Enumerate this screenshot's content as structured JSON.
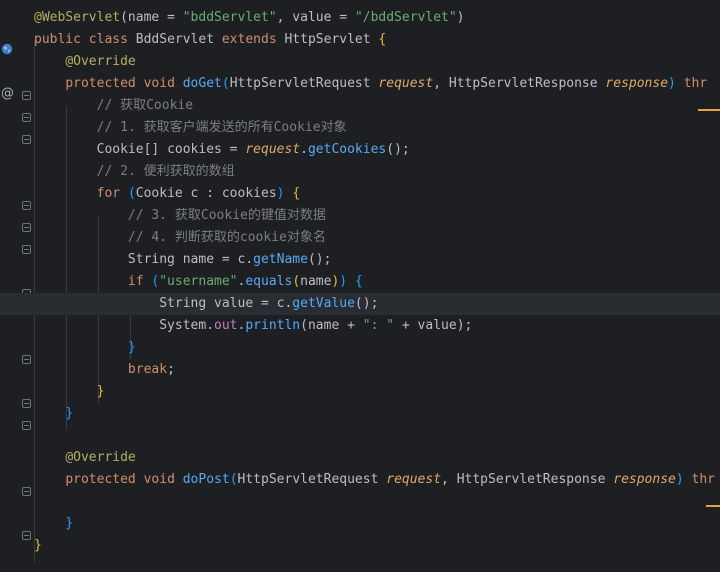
{
  "editor": {
    "language": "java",
    "lines": [
      [
        [
          "@WebServlet",
          "c-ann"
        ],
        [
          "(",
          "c-punct"
        ],
        [
          "name",
          "c-plain"
        ],
        [
          " = ",
          "c-plain"
        ],
        [
          "\"bddServlet\"",
          "c-str"
        ],
        [
          ", ",
          "c-plain"
        ],
        [
          "value",
          "c-plain"
        ],
        [
          " = ",
          "c-plain"
        ],
        [
          "\"/bddServlet\"",
          "c-str"
        ],
        [
          ")",
          "c-punct"
        ]
      ],
      [
        [
          "public ",
          "c-kw"
        ],
        [
          "class ",
          "c-kw"
        ],
        [
          "BddServlet ",
          "c-plain"
        ],
        [
          "extends ",
          "c-kw"
        ],
        [
          "HttpServlet ",
          "c-plain"
        ],
        [
          "{",
          "c-brace"
        ]
      ],
      [
        [
          "    ",
          "c-plain"
        ],
        [
          "@Override",
          "c-ann"
        ]
      ],
      [
        [
          "    ",
          "c-plain"
        ],
        [
          "protected ",
          "c-kw"
        ],
        [
          "void ",
          "c-kw"
        ],
        [
          "doGet",
          "c-fn"
        ],
        [
          "(",
          "c-brace2"
        ],
        [
          "HttpServletRequest ",
          "c-plain"
        ],
        [
          "request",
          "c-param"
        ],
        [
          ", ",
          "c-plain"
        ],
        [
          "HttpServletResponse ",
          "c-plain"
        ],
        [
          "response",
          "c-param"
        ],
        [
          ") ",
          "c-brace2"
        ],
        [
          "thr",
          "c-kw"
        ]
      ],
      [
        [
          "        ",
          "c-plain"
        ],
        [
          "// 获取Cookie",
          "c-cmt"
        ]
      ],
      [
        [
          "        ",
          "c-plain"
        ],
        [
          "// 1. 获取客户端发送的所有Cookie对象",
          "c-cmt"
        ]
      ],
      [
        [
          "        ",
          "c-plain"
        ],
        [
          "Cookie[] cookies = ",
          "c-plain"
        ],
        [
          "request",
          "c-param"
        ],
        [
          ".",
          "c-plain"
        ],
        [
          "getCookies",
          "c-mcall"
        ],
        [
          "();",
          "c-plain"
        ]
      ],
      [
        [
          "        ",
          "c-plain"
        ],
        [
          "// 2. 便利获取的数组",
          "c-cmt"
        ]
      ],
      [
        [
          "        ",
          "c-plain"
        ],
        [
          "for ",
          "c-kw"
        ],
        [
          "(",
          "c-brace2"
        ],
        [
          "Cookie c : cookies",
          "c-plain"
        ],
        [
          ") ",
          "c-brace2"
        ],
        [
          "{",
          "c-brace"
        ]
      ],
      [
        [
          "            ",
          "c-plain"
        ],
        [
          "// 3. 获取Cookie的键值对数据",
          "c-cmt"
        ]
      ],
      [
        [
          "            ",
          "c-plain"
        ],
        [
          "// 4. 判断获取的cookie对象名",
          "c-cmt"
        ]
      ],
      [
        [
          "            ",
          "c-plain"
        ],
        [
          "String name = c.",
          "c-plain"
        ],
        [
          "getName",
          "c-mcall"
        ],
        [
          "();",
          "c-plain"
        ]
      ],
      [
        [
          "            ",
          "c-plain"
        ],
        [
          "if ",
          "c-kw"
        ],
        [
          "(",
          "c-brace2"
        ],
        [
          "\"username\"",
          "c-str"
        ],
        [
          ".",
          "c-plain"
        ],
        [
          "equals",
          "c-mcall"
        ],
        [
          "(",
          "c-brace"
        ],
        [
          "name",
          "c-plain"
        ],
        [
          ")",
          "c-brace"
        ],
        [
          ") ",
          "c-brace2"
        ],
        [
          "{",
          "c-brace2"
        ]
      ],
      [
        [
          "                ",
          "c-plain"
        ],
        [
          "String value = c.",
          "c-plain"
        ],
        [
          "getValue",
          "c-mcall"
        ],
        [
          "();",
          "c-plain"
        ]
      ],
      [
        [
          "                ",
          "c-plain"
        ],
        [
          "System.",
          "c-plain"
        ],
        [
          "out",
          "c-field"
        ],
        [
          ".",
          "c-plain"
        ],
        [
          "println",
          "c-mcall"
        ],
        [
          "(name + ",
          "c-plain"
        ],
        [
          "\": \"",
          "c-str"
        ],
        [
          " + value);",
          "c-plain"
        ]
      ],
      [
        [
          "            ",
          "c-plain"
        ],
        [
          "}",
          "c-brace2"
        ]
      ],
      [
        [
          "            ",
          "c-plain"
        ],
        [
          "break",
          "c-kw"
        ],
        [
          ";",
          "c-plain"
        ]
      ],
      [
        [
          "        ",
          "c-plain"
        ],
        [
          "}",
          "c-brace"
        ]
      ],
      [
        [
          "    ",
          "c-plain"
        ],
        [
          "}",
          "c-brace2"
        ]
      ],
      [
        [
          "",
          "c-plain"
        ]
      ],
      [
        [
          "    ",
          "c-plain"
        ],
        [
          "@Override",
          "c-ann"
        ]
      ],
      [
        [
          "    ",
          "c-plain"
        ],
        [
          "protected ",
          "c-kw"
        ],
        [
          "void ",
          "c-kw"
        ],
        [
          "doPost",
          "c-fn"
        ],
        [
          "(",
          "c-brace2"
        ],
        [
          "HttpServletRequest ",
          "c-plain"
        ],
        [
          "request",
          "c-param"
        ],
        [
          ", ",
          "c-plain"
        ],
        [
          "HttpServletResponse ",
          "c-plain"
        ],
        [
          "response",
          "c-param"
        ],
        [
          ") ",
          "c-brace2"
        ],
        [
          "thr",
          "c-kw"
        ]
      ],
      [
        [
          "",
          "c-plain"
        ]
      ],
      [
        [
          "    ",
          "c-plain"
        ],
        [
          "}",
          "c-brace2"
        ]
      ],
      [
        [
          "}",
          "c-brace"
        ]
      ]
    ]
  },
  "gutter": {
    "web_icon": "globe-icon",
    "override_icon": "@"
  },
  "colors": {
    "background": "#1e1f22",
    "current_line": "#2a2c33",
    "keyword": "#cf8e6d",
    "string": "#6aab73",
    "comment": "#7a7e85",
    "method": "#56a8f5",
    "annotation": "#b3ae60"
  }
}
